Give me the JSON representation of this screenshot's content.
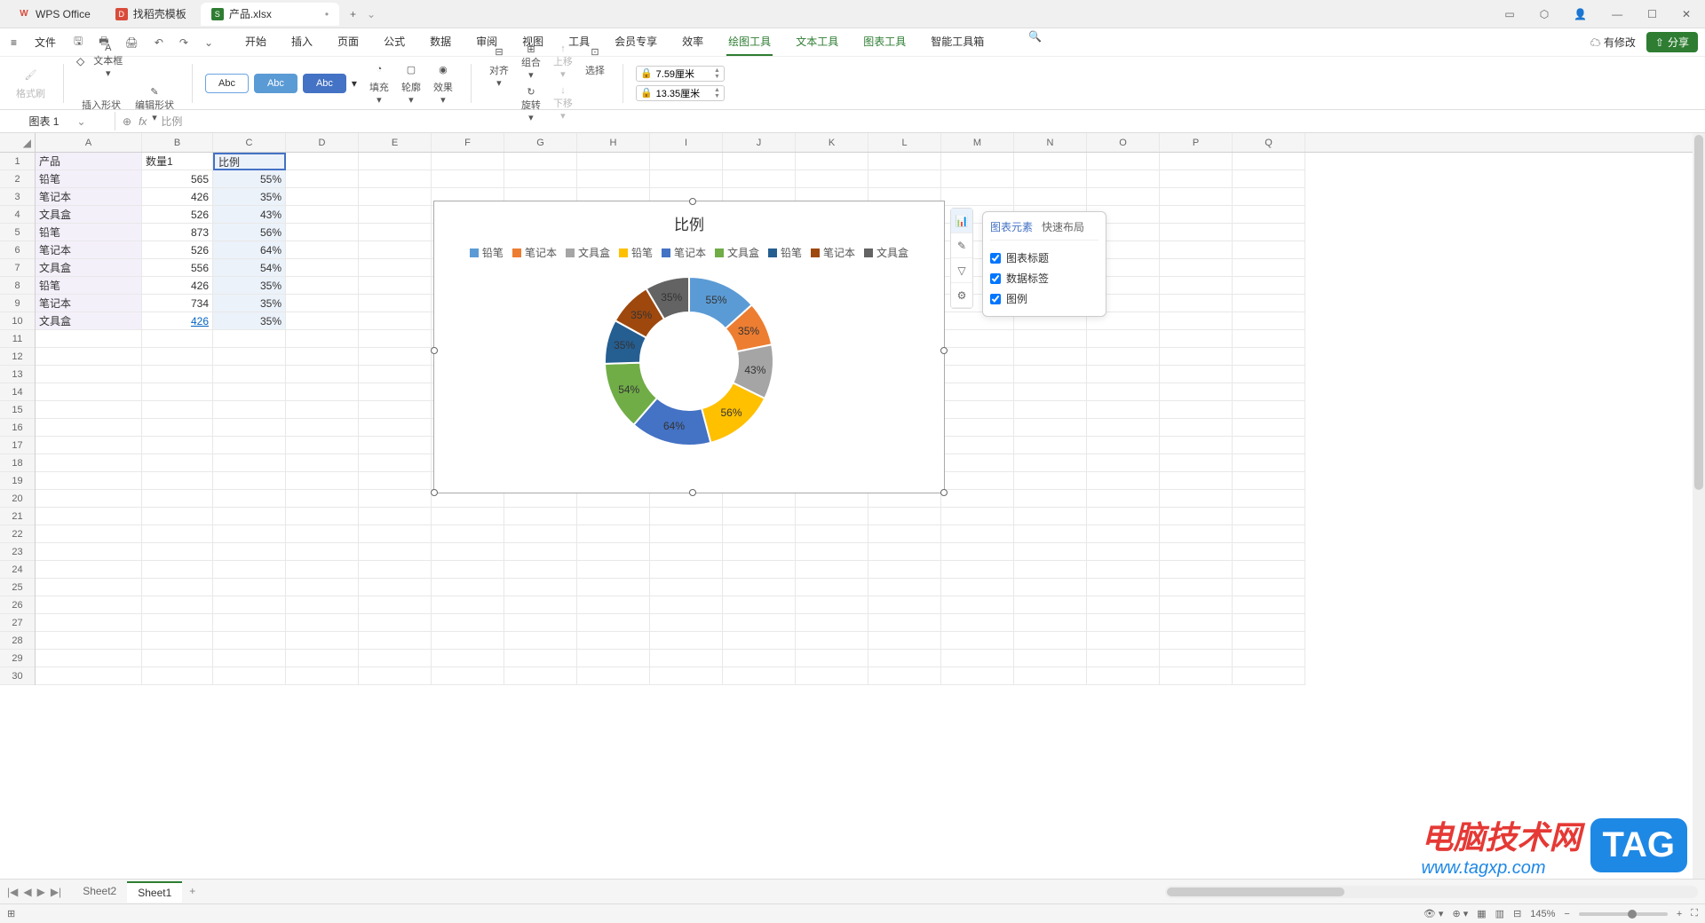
{
  "titlebar": {
    "tabs": [
      {
        "label": "WPS Office",
        "icon": "W"
      },
      {
        "label": "找稻壳模板",
        "icon": "D"
      },
      {
        "label": "产品.xlsx",
        "icon": "S",
        "modified": "•"
      }
    ],
    "add": "+"
  },
  "menubar": {
    "file": "文件",
    "tabs": [
      "开始",
      "插入",
      "页面",
      "公式",
      "数据",
      "审阅",
      "视图",
      "工具",
      "会员专享",
      "效率",
      "绘图工具",
      "文本工具",
      "图表工具",
      "智能工具箱"
    ],
    "active": "绘图工具",
    "modify": "有修改",
    "share": "分享"
  },
  "ribbon": {
    "format_painter": "格式刷",
    "insert_shape": "插入形状",
    "text_box": "文本框",
    "edit_shape": "编辑形状",
    "abc": [
      "Abc",
      "Abc",
      "Abc"
    ],
    "fill": "填充",
    "outline": "轮廓",
    "effect": "效果",
    "align": "对齐",
    "group": "组合",
    "rotate": "旋转",
    "move_up": "上移",
    "move_down": "下移",
    "select": "选择",
    "height": "7.59厘米",
    "width": "13.35厘米"
  },
  "formula_bar": {
    "name": "图表 1",
    "fx": "fx",
    "value": "比例"
  },
  "headers": {
    "cols": [
      "A",
      "B",
      "C",
      "D",
      "E",
      "F",
      "G",
      "H",
      "I",
      "J",
      "K",
      "L",
      "M",
      "N",
      "O",
      "P",
      "Q"
    ],
    "rows_count": 30
  },
  "table": {
    "header": [
      "产品",
      "数量1",
      "比例"
    ],
    "rows": [
      [
        "铅笔",
        "565",
        "55%"
      ],
      [
        "笔记本",
        "426",
        "35%"
      ],
      [
        "文具盒",
        "526",
        "43%"
      ],
      [
        "铅笔",
        "873",
        "56%"
      ],
      [
        "笔记本",
        "526",
        "64%"
      ],
      [
        "文具盒",
        "556",
        "54%"
      ],
      [
        "铅笔",
        "426",
        "35%"
      ],
      [
        "笔记本",
        "734",
        "35%"
      ],
      [
        "文具盒",
        "426",
        "35%"
      ]
    ]
  },
  "chart_data": {
    "type": "pie",
    "title": "比例",
    "categories": [
      "铅笔",
      "笔记本",
      "文具盒",
      "铅笔",
      "笔记本",
      "文具盒",
      "铅笔",
      "笔记本",
      "文具盒"
    ],
    "values": [
      55,
      35,
      43,
      56,
      64,
      54,
      35,
      35,
      35
    ],
    "labels": [
      "55%",
      "35%",
      "43%",
      "56%",
      "64%",
      "54%",
      "35%",
      "35%",
      "35%"
    ],
    "colors": [
      "#5b9bd5",
      "#ed7d31",
      "#a5a5a5",
      "#ffc000",
      "#4472c4",
      "#70ad47",
      "#255e91",
      "#9e480e",
      "#636363"
    ]
  },
  "chart_popup": {
    "tab1": "图表元素",
    "tab2": "快速布局",
    "checks": [
      "图表标题",
      "数据标签",
      "图例"
    ]
  },
  "sheets": {
    "list": [
      "Sheet2",
      "Sheet1"
    ],
    "active": "Sheet1",
    "add": "+"
  },
  "status": {
    "zoom": "145%"
  },
  "watermark": {
    "text": "电脑技术网",
    "tag": "TAG",
    "url": "www.tagxp.com"
  }
}
